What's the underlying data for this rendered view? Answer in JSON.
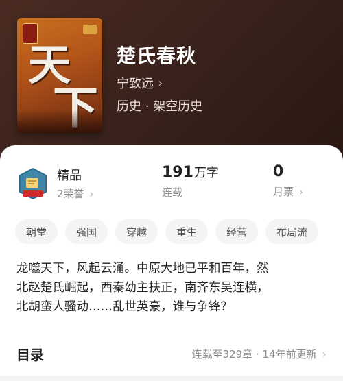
{
  "book": {
    "title": "楚氏春秋",
    "author": "宁致远",
    "genre": "历史 · 架空历史",
    "cover_text_1": "天",
    "cover_text_2": "下"
  },
  "quality": {
    "label": "精品",
    "sub": "2荣誉"
  },
  "word_count": {
    "value": "191",
    "unit": "万字",
    "status": "连载"
  },
  "monthly_ticket": {
    "value": "0",
    "label": "月票"
  },
  "tags": [
    "朝堂",
    "强国",
    "穿越",
    "重生",
    "经营",
    "布局流"
  ],
  "synopsis": {
    "lines": [
      "龙噬天下，风起云涌。中原大地已平和百年，然",
      "北赵楚氏崛起，西秦幼主扶正，南齐东吴连横，",
      "北胡蛮人骚动……乱世英豪，谁与争锋？"
    ]
  },
  "toc": {
    "title": "目录",
    "info": "连载至329章 · 14年前更新"
  },
  "colors": {
    "sheet": "#ffffff",
    "hero": "#3a231c",
    "muted": "#8d8d8d"
  }
}
